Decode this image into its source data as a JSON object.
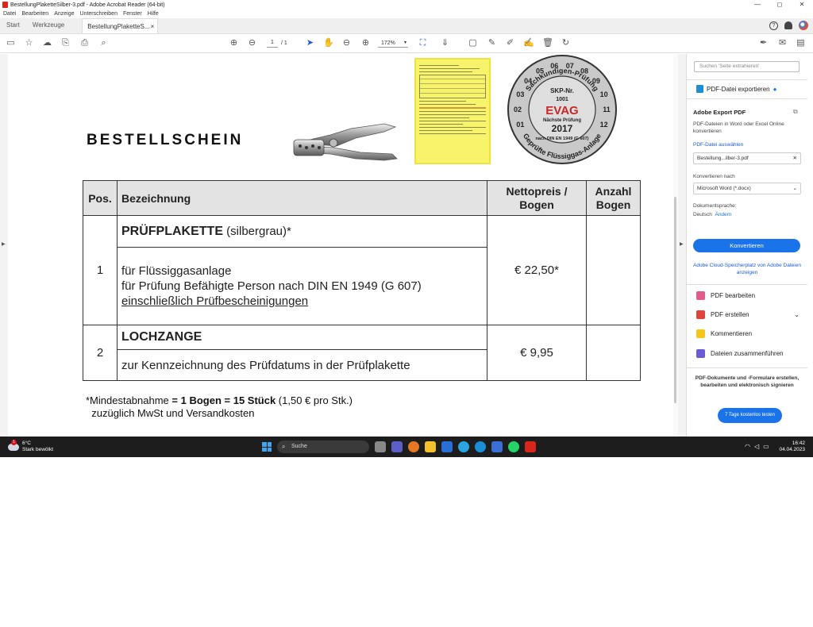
{
  "window": {
    "title": "BestellungPlaketteSilber-3.pdf - Adobe Acrobat Reader (64-bit)",
    "controls": [
      "—",
      "◻",
      "✕"
    ]
  },
  "menu": [
    "Datei",
    "Bearbeiten",
    "Anzeige",
    "Unterschreiben",
    "Fenster",
    "Hilfe"
  ],
  "tabs": {
    "start": "Start",
    "tools": "Werkzeuge",
    "document": "BestellungPlaketteS...",
    "close": "×"
  },
  "toolbar": {
    "page_current": "1",
    "page_total": "/ 1",
    "zoom": "172%"
  },
  "document": {
    "heading": "BESTELLSCHEIN",
    "seal": {
      "top_text": "Sachkundigen-Prüfung",
      "ring_numbers": [
        "01",
        "02",
        "03",
        "04",
        "05",
        "06",
        "07",
        "08",
        "09",
        "10",
        "11",
        "12"
      ],
      "skp": "SKP-Nr.",
      "skp_num": "1001",
      "brand": "EVAG",
      "next": "Nächste Prüfung",
      "year": "2017",
      "din": "nach DIN EN 1949 (G 607)",
      "bottom_text": "Geprüfte Flüssiggas-Anlage"
    },
    "table": {
      "headers": {
        "pos": "Pos.",
        "bez": "Bezeichnung",
        "price_l1": "Nettopreis /",
        "price_l2": "Bogen",
        "qty_l1": "Anzahl",
        "qty_l2": "Bogen"
      },
      "rows": [
        {
          "pos": "1",
          "title_bold": "PRÜFPLAKETTE",
          "title_rest": " (silbergrau)*",
          "line1": "für Flüssiggasanlage",
          "line2": "für Prüfung Befähigte Person nach DIN EN 1949 (G 607)",
          "line3": "einschließlich Prüfbescheinigungen",
          "price": "€ 22,50*"
        },
        {
          "pos": "2",
          "title_bold": "LOCHZANGE",
          "line1": "zur Kennzeichnung des Prüfdatums in der Prüfplakette",
          "price": "€ 9,95"
        }
      ]
    },
    "footnote": {
      "pre": "*Mindestabnahme ",
      "bold": "= 1 Bogen = 15 Stück",
      "post": " (1,50 € pro Stk.)",
      "line2": "zuzüglich MwSt und Versandkosten"
    }
  },
  "panel": {
    "search_placeholder": "Suchen 'Seite extrahieren'",
    "export_title": "PDF-Datei exportieren",
    "aep_title": "Adobe Export PDF",
    "aep_desc": "PDF-Dateien in Word oder Excel Online konvertieren",
    "select_file": "PDF-Datei auswählen",
    "file_name": "Bestellung...ilber-3.pdf",
    "convert_to_label": "Konvertieren nach",
    "convert_to_value": "Microsoft Word (*.docx)",
    "lang_label": "Dokumentsprache:",
    "lang_value": "Deutsch",
    "lang_change": "Ändern",
    "convert_button": "Konvertieren",
    "cloud_link": "Adobe Cloud-Speicherplatz von Adobe Dateien anzeigen",
    "tools": [
      "PDF bearbeiten",
      "PDF erstellen",
      "Kommentieren",
      "Dateien zusammenführen"
    ],
    "promo": "PDF-Dokumente und -Formulare erstellen, bearbeiten und elektronisch signieren",
    "trial_button": "7 Tage kostenlos testen"
  },
  "taskbar": {
    "temp": "6°C",
    "weather": "Stark bewölkt",
    "weather_badge": "1",
    "search": "Suche",
    "time": "16:42",
    "date": "04.04.2023"
  },
  "colors": {
    "accent": "#1a73e8",
    "seal_red": "#c62828",
    "form_yellow": "#f7f36b"
  }
}
